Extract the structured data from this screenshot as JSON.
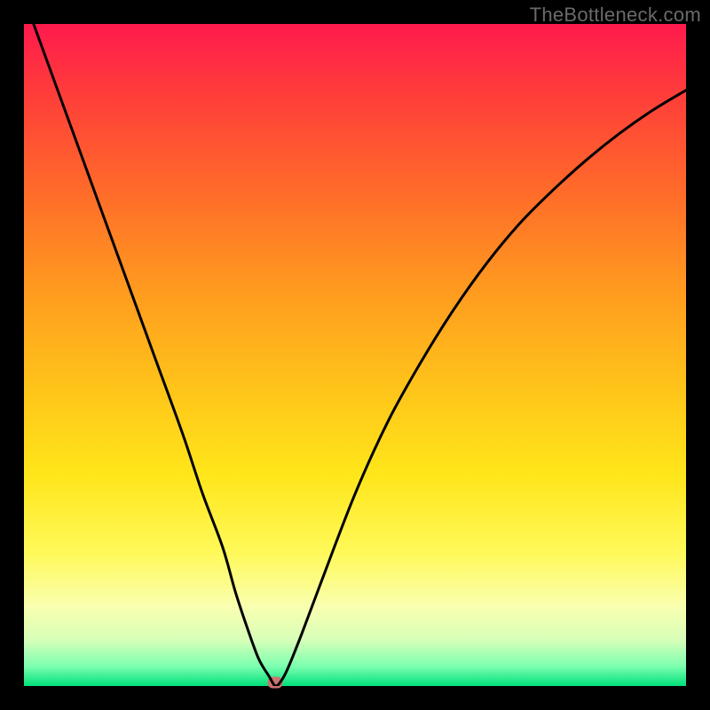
{
  "watermark": "TheBottleneck.com",
  "chart_data": {
    "type": "line",
    "title": "",
    "xlabel": "",
    "ylabel": "",
    "xlim": [
      0,
      100
    ],
    "ylim": [
      0,
      100
    ],
    "grid": false,
    "legend": false,
    "series": [
      {
        "name": "bottleneck-curve",
        "x": [
          0,
          4,
          8,
          12,
          16,
          20,
          24,
          27,
          30,
          32,
          34,
          35.5,
          37,
          38,
          39,
          40,
          42,
          45,
          50,
          55,
          60,
          65,
          70,
          75,
          80,
          85,
          90,
          95,
          100
        ],
        "y": [
          104,
          93,
          82,
          71,
          60,
          49,
          38,
          29,
          21,
          14,
          8,
          4,
          1.5,
          0,
          1,
          3,
          8,
          16,
          29,
          40,
          49,
          57,
          64,
          70,
          75,
          79.5,
          83.5,
          87,
          90
        ]
      }
    ],
    "marker": {
      "x": 38,
      "y": 0.5,
      "color": "#c9746f"
    },
    "gradient_stops": [
      {
        "pos": 0,
        "color": "#ff1a4d"
      },
      {
        "pos": 10,
        "color": "#ff3b3b"
      },
      {
        "pos": 25,
        "color": "#ff6a2a"
      },
      {
        "pos": 40,
        "color": "#ff9a1f"
      },
      {
        "pos": 55,
        "color": "#ffc41a"
      },
      {
        "pos": 68,
        "color": "#ffe61a"
      },
      {
        "pos": 80,
        "color": "#fff95a"
      },
      {
        "pos": 88,
        "color": "#f9ffb0"
      },
      {
        "pos": 93,
        "color": "#d8ffb8"
      },
      {
        "pos": 97,
        "color": "#7dffb0"
      },
      {
        "pos": 100,
        "color": "#00e07a"
      }
    ]
  }
}
